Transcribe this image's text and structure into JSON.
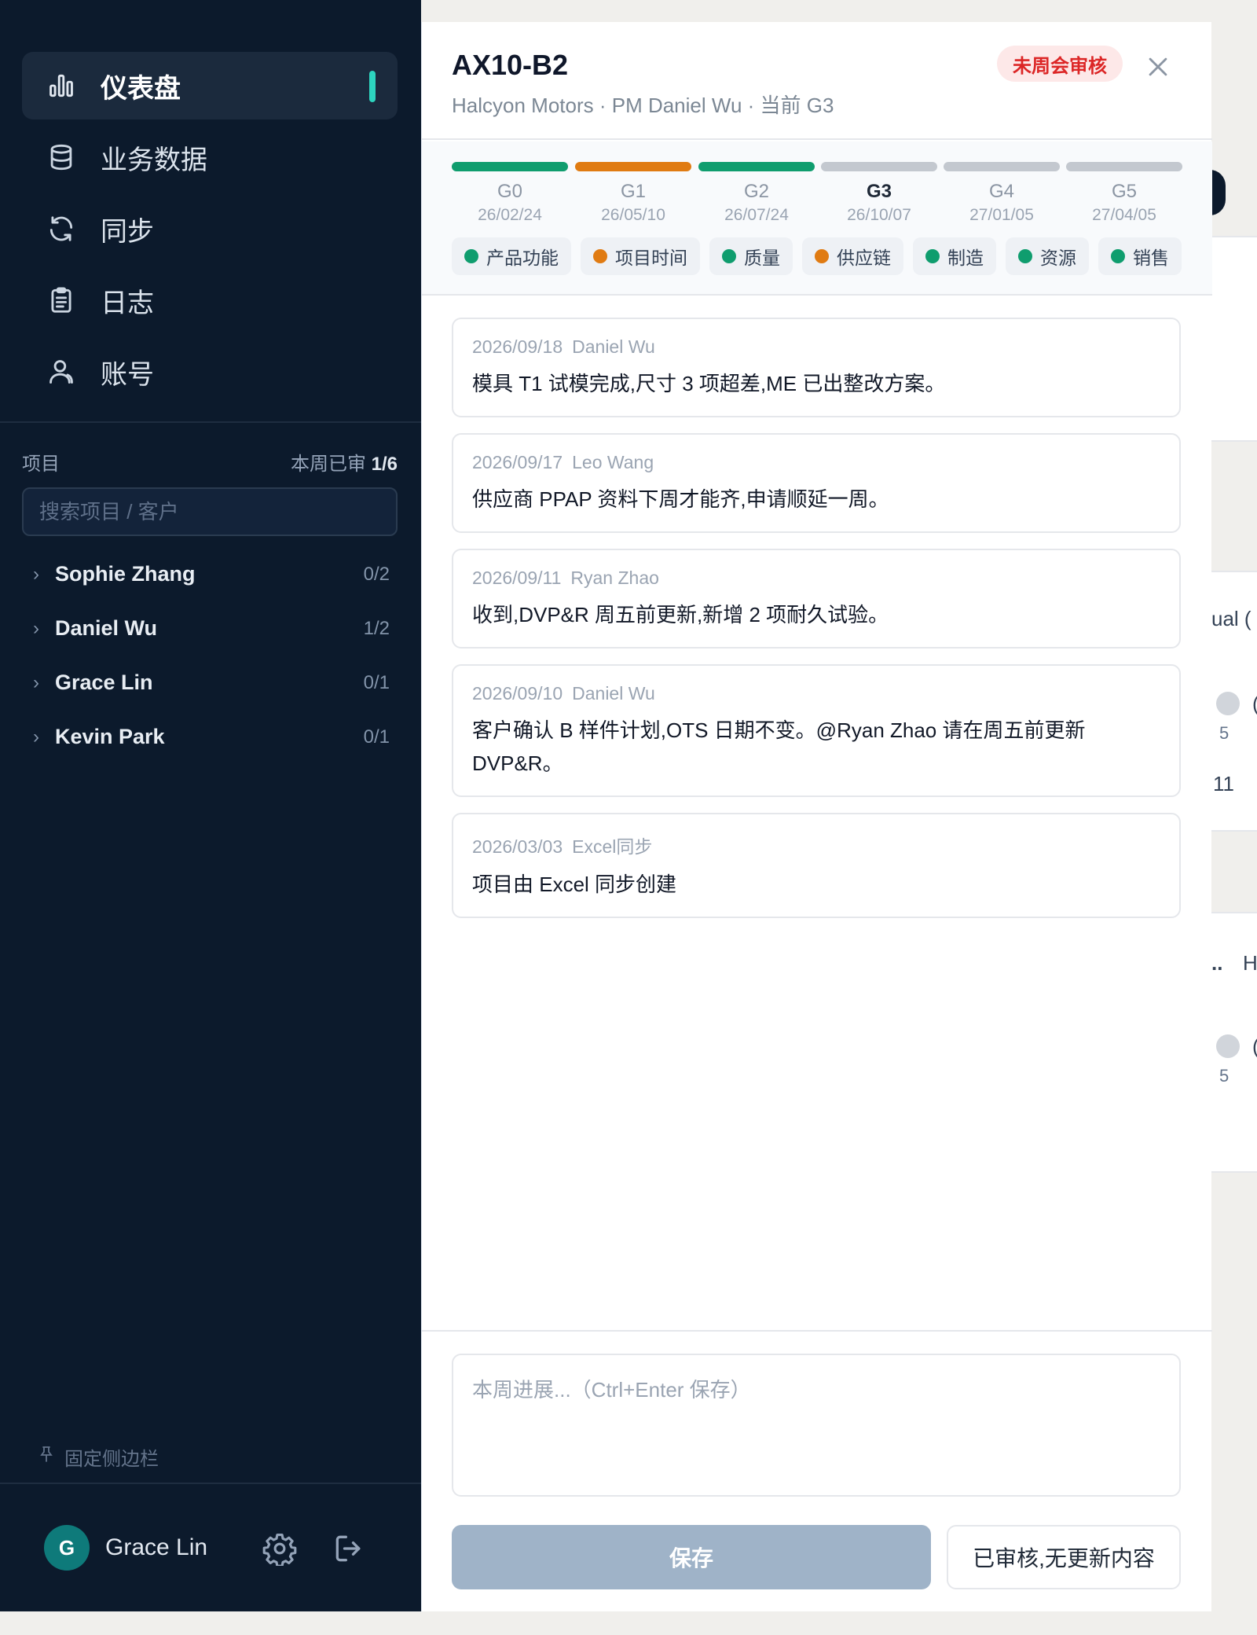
{
  "nav": {
    "items": [
      {
        "label": "仪表盘",
        "icon": "bar-chart-icon"
      },
      {
        "label": "业务数据",
        "icon": "database-icon"
      },
      {
        "label": "同步",
        "icon": "sync-icon"
      },
      {
        "label": "日志",
        "icon": "clipboard-icon"
      },
      {
        "label": "账号",
        "icon": "user-icon"
      }
    ],
    "active": "仪表盘"
  },
  "projects": {
    "title": "项目",
    "review_label": "本周已审",
    "review_value": "1/6",
    "search_placeholder": "搜索项目 / 客户",
    "pms": [
      {
        "name": "Sophie Zhang",
        "count": "0/2"
      },
      {
        "name": "Daniel Wu",
        "count": "1/2"
      },
      {
        "name": "Grace Lin",
        "count": "0/1"
      },
      {
        "name": "Kevin Park",
        "count": "0/1"
      }
    ]
  },
  "sidebar_footer": {
    "pin_label": "固定侧边栏",
    "user_initial": "G",
    "user_name": "Grace Lin"
  },
  "panel": {
    "title": "AX10-B2",
    "subtitle": "Halcyon Motors · PM Daniel Wu · 当前 G3",
    "badge": "未周会审核",
    "gates": [
      {
        "name": "G0",
        "date": "26/02/24",
        "status": "green"
      },
      {
        "name": "G1",
        "date": "26/05/10",
        "status": "orange"
      },
      {
        "name": "G2",
        "date": "26/07/24",
        "status": "green"
      },
      {
        "name": "G3",
        "date": "26/10/07",
        "status": "gray",
        "current": true
      },
      {
        "name": "G4",
        "date": "27/01/05",
        "status": "gray"
      },
      {
        "name": "G5",
        "date": "27/04/05",
        "status": "gray"
      }
    ],
    "categories": [
      {
        "label": "产品功能",
        "status": "green"
      },
      {
        "label": "项目时间",
        "status": "orange"
      },
      {
        "label": "质量",
        "status": "green"
      },
      {
        "label": "供应链",
        "status": "orange"
      },
      {
        "label": "制造",
        "status": "green"
      },
      {
        "label": "资源",
        "status": "green"
      },
      {
        "label": "销售",
        "status": "green"
      }
    ],
    "logs": [
      {
        "date": "2026/09/18",
        "author": "Daniel Wu",
        "text": "模具 T1 试模完成,尺寸 3 项超差,ME 已出整改方案。"
      },
      {
        "date": "2026/09/17",
        "author": "Leo Wang",
        "text": "供应商 PPAP 资料下周才能齐,申请顺延一周。"
      },
      {
        "date": "2026/09/11",
        "author": "Ryan Zhao",
        "text": "收到,DVP&R 周五前更新,新增 2 项耐久试验。"
      },
      {
        "date": "2026/09/10",
        "author": "Daniel Wu",
        "text": "客户确认 B 样件计划,OTS 日期不变。@Ryan Zhao 请在周五前更新 DVP&R。"
      },
      {
        "date": "2026/03/03",
        "author": "Excel同步",
        "text": "项目由 Excel 同步创建"
      }
    ],
    "note_placeholder": "本周进展...（Ctrl+Enter 保存）",
    "save_label": "保存",
    "reviewed_label": "已审核,无更新内容"
  },
  "background": {
    "peek_texts": [
      "ual (",
      "(",
      "5",
      "11",
      "..",
      "H",
      "(",
      "5"
    ]
  },
  "colors": {
    "green": "#0f9d6e",
    "orange": "#e07b12",
    "gray": "#c3c8cf",
    "accent": "#2dd4bf",
    "sidebar": "#0c1a2c"
  }
}
